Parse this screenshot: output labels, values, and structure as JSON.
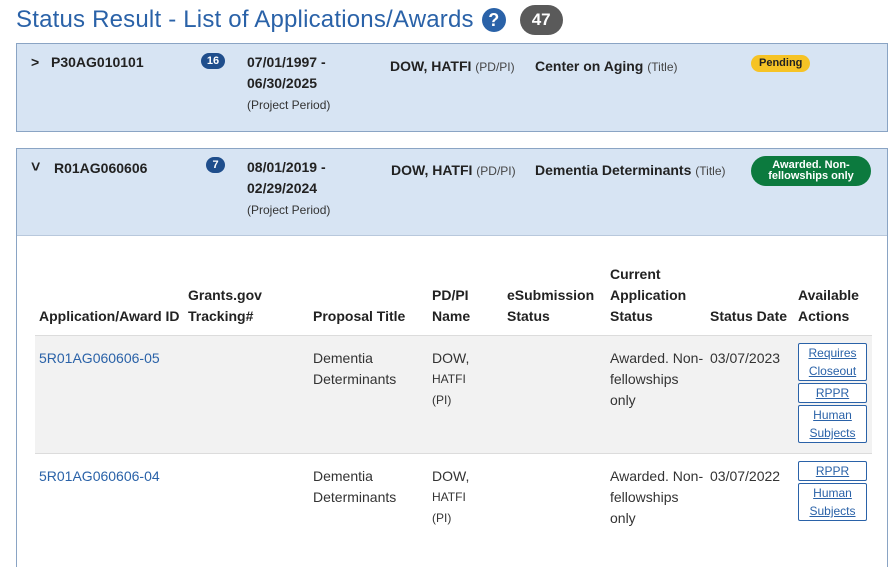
{
  "header": {
    "title": "Status Result - List of Applications/Awards",
    "help_icon": "?",
    "count": "47"
  },
  "awards": [
    {
      "chevron": ">",
      "id": "P30AG010101",
      "count": "16",
      "period_line1": "07/01/1997 -",
      "period_line2": "06/30/2025",
      "period_note": "(Project Period)",
      "pi": "DOW, HATFI",
      "pi_role": "(PD/PI)",
      "title": "Center on Aging",
      "title_note": "(Title)",
      "status": "Pending"
    },
    {
      "chevron": "˅",
      "id": "R01AG060606",
      "count": "7",
      "period_line1": "08/01/2019 -",
      "period_line2": "02/29/2024",
      "period_note": "(Project Period)",
      "pi": "DOW, HATFI",
      "pi_role": "(PD/PI)",
      "title": "Dementia Determinants",
      "title_note": "(Title)",
      "status": "Awarded. Non-fellowships only"
    }
  ],
  "table": {
    "columns": [
      "Application/Award ID",
      "Grants.gov Tracking#",
      "Proposal Title",
      "PD/PI Name",
      "eSubmission Status",
      "Current Application Status",
      "Status Date",
      "Available Actions"
    ],
    "rows": [
      {
        "id": "5R01AG060606-05",
        "tracking": "",
        "proposal": "Dementia Determinants",
        "pi_name": "DOW,",
        "pi_name2": "HATFI",
        "pi_role": "(PI)",
        "esub": "",
        "status": "Awarded. Non-fellowships only",
        "date": "03/07/2023",
        "actions": [
          "Requires Closeout",
          "RPPR",
          "Human Subjects"
        ]
      },
      {
        "id": "5R01AG060606-04",
        "tracking": "",
        "proposal": "Dementia Determinants",
        "pi_name": "DOW,",
        "pi_name2": "HATFI",
        "pi_role": "(PI)",
        "esub": "",
        "status": "Awarded. Non-fellowships only",
        "date": "03/07/2022",
        "actions": [
          "RPPR",
          "Human Subjects"
        ]
      }
    ]
  }
}
